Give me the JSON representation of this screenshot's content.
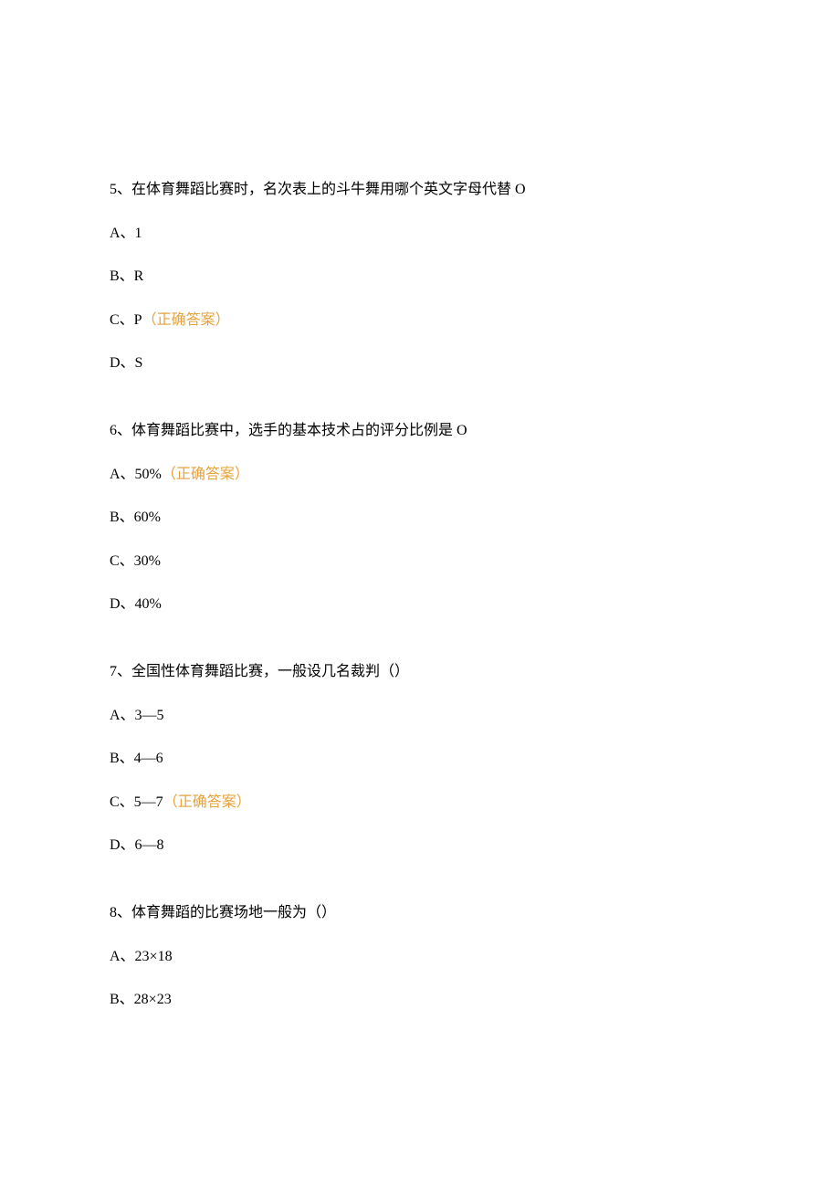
{
  "correct_label": "（正确答案）",
  "questions": [
    {
      "number": "5",
      "text": "在体育舞蹈比赛时，名次表上的斗牛舞用哪个英文字母代替 O",
      "options": [
        {
          "label": "A、1",
          "correct": false
        },
        {
          "label": "B、R",
          "correct": false
        },
        {
          "label": "C、P",
          "correct": true
        },
        {
          "label": "D、S",
          "correct": false
        }
      ]
    },
    {
      "number": "6",
      "text": "体育舞蹈比赛中，选手的基本技术占的评分比例是 O",
      "options": [
        {
          "label": "A、50%",
          "correct": true
        },
        {
          "label": "B、60%",
          "correct": false
        },
        {
          "label": "C、30%",
          "correct": false
        },
        {
          "label": "D、40%",
          "correct": false
        }
      ]
    },
    {
      "number": "7",
      "text": "全国性体育舞蹈比赛，一般设几名裁判（）",
      "options": [
        {
          "label": "A、3—5",
          "correct": false
        },
        {
          "label": "B、4—6",
          "correct": false
        },
        {
          "label": "C、5—7",
          "correct": true
        },
        {
          "label": "D、6—8",
          "correct": false
        }
      ]
    },
    {
      "number": "8",
      "text": "体育舞蹈的比赛场地一般为（）",
      "options": [
        {
          "label": "A、23×18",
          "correct": false
        },
        {
          "label": "B、28×23",
          "correct": false
        }
      ]
    }
  ]
}
